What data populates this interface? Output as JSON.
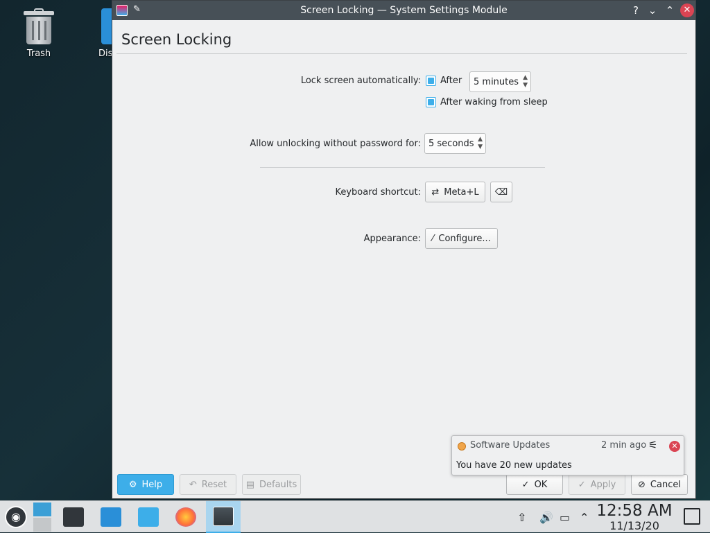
{
  "desktop": {
    "trash_label": "Trash",
    "second_icon_label": "Dis"
  },
  "window": {
    "title": "Screen Locking — System Settings Module",
    "heading": "Screen Locking",
    "titlebar_buttons": {
      "help": "?",
      "minimize": "⌄",
      "maximize": "⌃",
      "close": "✕"
    },
    "lock_auto": {
      "label": "Lock screen automatically:",
      "after_label": "After",
      "after_checked": true,
      "after_value": "5 minutes",
      "after_sleep_label": "After waking from sleep",
      "after_sleep_checked": true
    },
    "unlock_grace": {
      "label": "Allow unlocking without password for:",
      "value": "5 seconds"
    },
    "shortcut": {
      "label": "Keyboard shortcut:",
      "value": "Meta+L"
    },
    "appearance": {
      "label": "Appearance:",
      "configure_label": "Configure..."
    },
    "footer": {
      "help": "Help",
      "reset": "Reset",
      "defaults": "Defaults",
      "ok": "OK",
      "apply": "Apply",
      "cancel": "Cancel"
    }
  },
  "notification": {
    "app": "Software Updates",
    "time": "2 min ago",
    "body": "You have 20 new updates"
  },
  "taskbar": {
    "apps": [
      "system-settings",
      "discover",
      "dolphin",
      "firefox",
      "screen-locking-settings"
    ],
    "active_app": "screen-locking-settings",
    "time": "12:58 AM",
    "date": "11/13/20"
  },
  "colors": {
    "accent": "#3daee9",
    "close": "#da4453",
    "titlebar": "#475057",
    "window_bg": "#eff0f1"
  }
}
